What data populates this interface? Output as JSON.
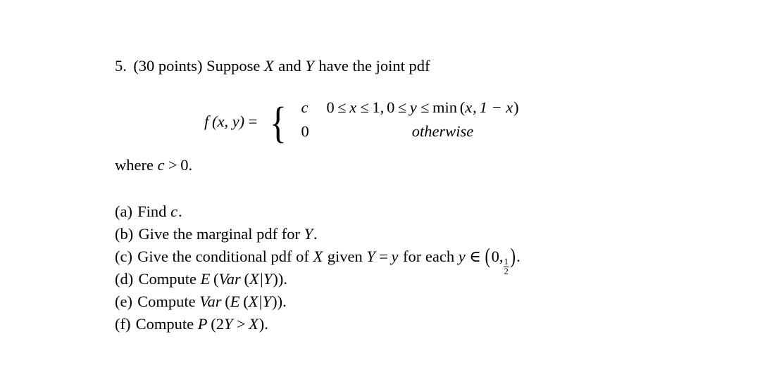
{
  "document": {
    "problem": {
      "number": "5.",
      "points": "(30 points)",
      "lead_text_1": "Suppose",
      "var_x": "X",
      "lead_text_2": "and",
      "var_y": "Y",
      "lead_text_3": "have the joint pdf"
    },
    "equation": {
      "function_name": "f",
      "function_args": "(x, y)",
      "equals": "=",
      "cases": [
        {
          "value": "c",
          "condition_parts": {
            "zero_a": "0",
            "le1": "≤",
            "x": "x",
            "le2": "≤",
            "one": "1,",
            "zero_b": "0",
            "le3": "≤",
            "y": "y",
            "le4": "≤",
            "min_op": "min",
            "min_args_open": "(",
            "min_arg1": "x",
            "comma": ",",
            "min_arg2": "1 − x",
            "min_args_close": ")"
          },
          "condition_text": "0 ≤ x ≤ 1, 0 ≤ y ≤ min (x, 1 − x)"
        },
        {
          "value": "0",
          "condition_text": "otherwise"
        }
      ]
    },
    "where_clause": {
      "text": "where",
      "variable": "c",
      "relation": ">",
      "value": "0."
    },
    "parts": [
      {
        "tag": "(a)",
        "text": "Find",
        "math": "c",
        "period": ".",
        "full_text": "(a) Find c."
      },
      {
        "tag": "(b)",
        "text": "Give the marginal pdf for",
        "math": "Y",
        "period": ".",
        "full_text": "(b) Give the marginal pdf for Y."
      },
      {
        "tag": "(c)",
        "text_1": "Give the conditional pdf of",
        "math_x": "X",
        "text_2": "given",
        "math_y": "Y",
        "equals": "=",
        "math_y_lower": "y",
        "text_3": "for each",
        "math_y_lower_2": "y",
        "member": "∈",
        "interval_open": "(",
        "interval_low": "0,",
        "frac_num": "1",
        "frac_den": "2",
        "interval_close": ")",
        "period": ".",
        "full_text": "(c) Give the conditional pdf of X given Y = y for each y ∈ (0, 1/2)."
      },
      {
        "tag": "(d)",
        "text": "Compute",
        "outer_op": "E",
        "inner_op": "Var",
        "arg_x": "X",
        "bar": "|",
        "arg_y": "Y",
        "period": ".",
        "full_text": "(d) Compute E (Var (X|Y))."
      },
      {
        "tag": "(e)",
        "text": "Compute",
        "outer_op": "Var",
        "inner_op": "E",
        "arg_x": "X",
        "bar": "|",
        "arg_y": "Y",
        "period": ".",
        "full_text": "(e) Compute Var (E (X|Y))."
      },
      {
        "tag": "(f)",
        "text": "Compute",
        "prob_op": "P",
        "expr_coef": "2",
        "expr_y": "Y",
        "expr_rel": ">",
        "expr_x": "X",
        "period": ".",
        "full_text": "(f) Compute P (2Y > X)."
      }
    ]
  },
  "style": {
    "background_color": "#ffffff",
    "text_color": "#000000"
  }
}
